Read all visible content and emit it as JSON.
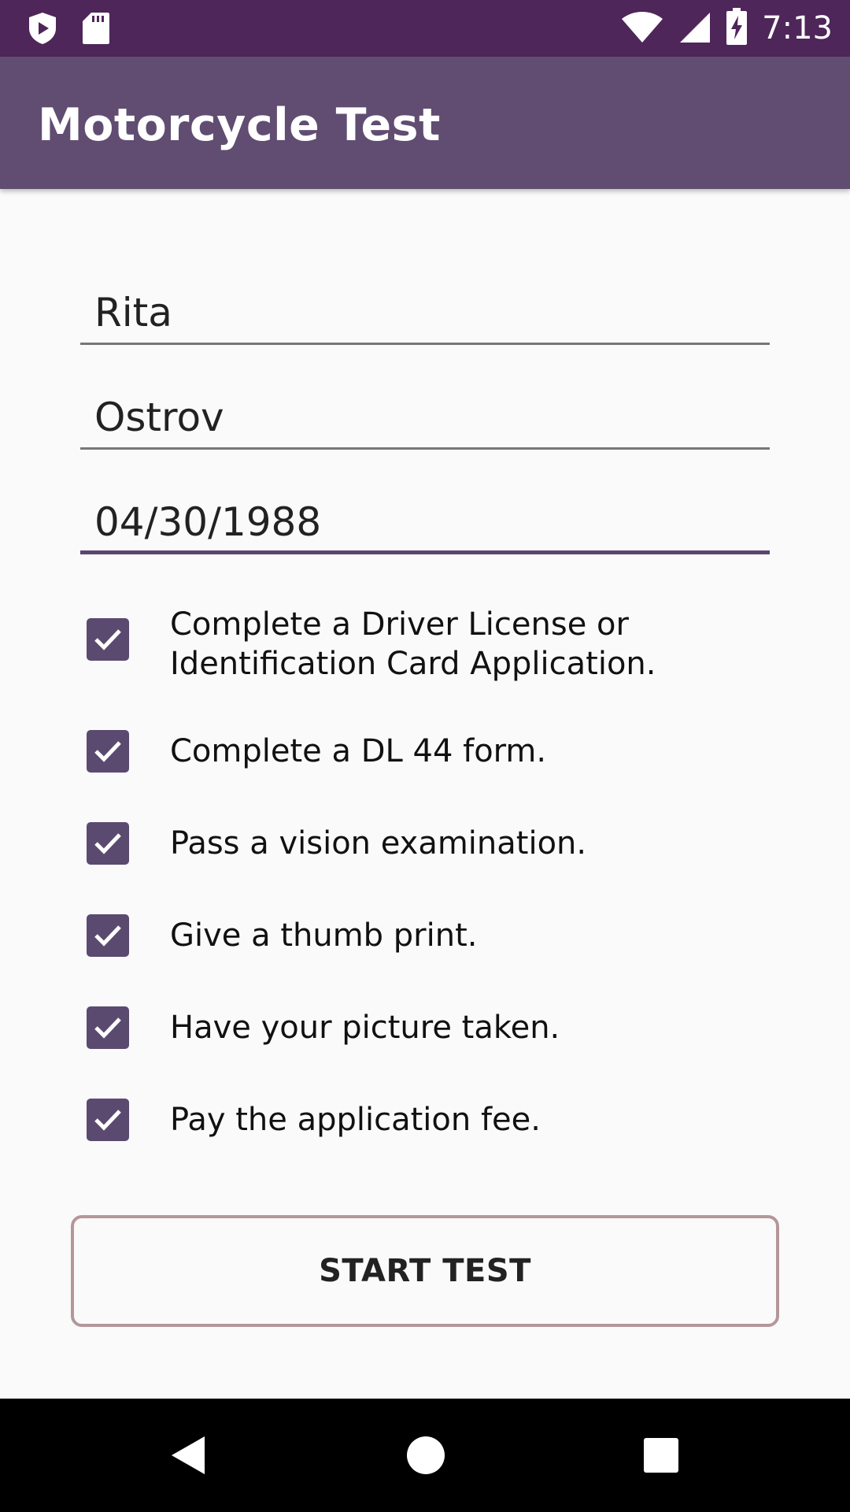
{
  "status_bar": {
    "time": "7:13",
    "icons": [
      "play-shield-icon",
      "sd-card-icon",
      "wifi-icon",
      "cell-signal-icon",
      "battery-charging-icon"
    ]
  },
  "app_bar": {
    "title": "Motorcycle Test"
  },
  "form": {
    "first_name": "Rita",
    "last_name": "Ostrov",
    "birth_date": "04/30/1988"
  },
  "checklist": [
    {
      "label": "Complete a Driver License or Identification Card Application.",
      "checked": true
    },
    {
      "label": "Complete a DL 44 form.",
      "checked": true
    },
    {
      "label": "Pass a vision examination.",
      "checked": true
    },
    {
      "label": "Give a thumb print.",
      "checked": true
    },
    {
      "label": "Have your picture taken.",
      "checked": true
    },
    {
      "label": "Pay the application fee.",
      "checked": true
    }
  ],
  "start_button": {
    "label": "START TEST"
  },
  "nav_bar": {
    "icons": [
      "back-icon",
      "home-icon",
      "recents-icon"
    ]
  },
  "colors": {
    "status_bar": "#4f2659",
    "app_bar": "#604d71",
    "accent": "#5b4a6f",
    "button_border": "#b4979b"
  }
}
